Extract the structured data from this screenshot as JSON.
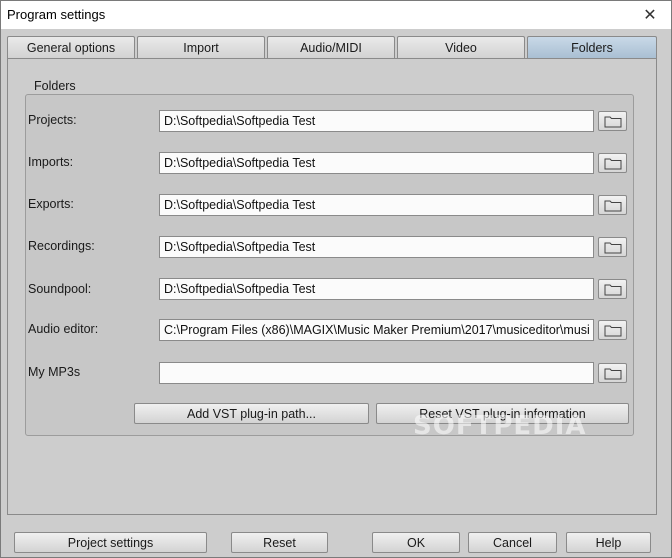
{
  "window": {
    "title": "Program settings",
    "close_glyph": "✕"
  },
  "tabs": [
    {
      "label": "General options"
    },
    {
      "label": "Import"
    },
    {
      "label": "Audio/MIDI"
    },
    {
      "label": "Video"
    },
    {
      "label": "Folders",
      "active": true
    }
  ],
  "folders": {
    "group_label": "Folders",
    "rows": [
      {
        "label": "Projects:",
        "value": "D:\\Softpedia\\Softpedia Test"
      },
      {
        "label": "Imports:",
        "value": "D:\\Softpedia\\Softpedia Test"
      },
      {
        "label": "Exports:",
        "value": "D:\\Softpedia\\Softpedia Test"
      },
      {
        "label": "Recordings:",
        "value": "D:\\Softpedia\\Softpedia Test"
      },
      {
        "label": "Soundpool:",
        "value": "D:\\Softpedia\\Softpedia Test"
      },
      {
        "label": "Audio editor:",
        "value": "C:\\Program Files (x86)\\MAGIX\\Music Maker Premium\\2017\\musiceditor\\musi"
      },
      {
        "label": "My MP3s",
        "value": ""
      }
    ],
    "add_vst_label": "Add VST plug-in path...",
    "reset_vst_label": "Reset VST plug-in information"
  },
  "footer": {
    "project_settings": "Project settings",
    "reset": "Reset",
    "ok": "OK",
    "cancel": "Cancel",
    "help": "Help"
  },
  "watermark": "SOFTPEDIA",
  "colors": {
    "active_tab": "#b3c7d9",
    "background": "#cdcdcd"
  }
}
